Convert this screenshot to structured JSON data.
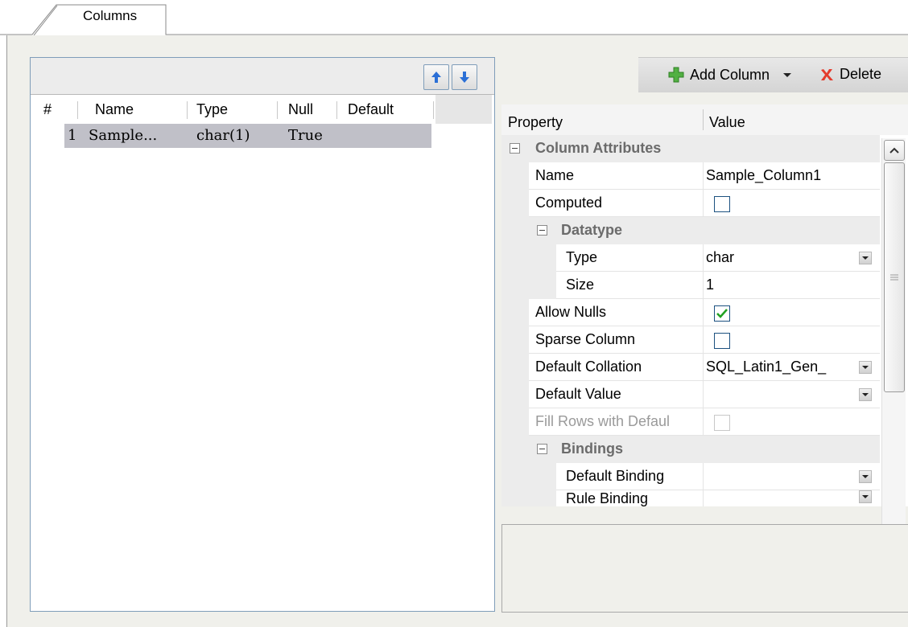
{
  "tab": {
    "label": "Columns"
  },
  "columns_grid": {
    "headers": [
      "#",
      "Name",
      "Type",
      "Null",
      "Default"
    ],
    "rows": [
      {
        "index": "1",
        "name": "Sample...",
        "type": "char(1)",
        "null": "True",
        "default": ""
      }
    ]
  },
  "toolbar": {
    "add_column": "Add Column",
    "delete": "Delete"
  },
  "properties": {
    "header_property": "Property",
    "header_value": "Value",
    "cat_column_attributes": "Column Attributes",
    "name_label": "Name",
    "name_value": "Sample_Column1",
    "computed_label": "Computed",
    "computed_checked": false,
    "cat_datatype": "Datatype",
    "type_label": "Type",
    "type_value": "char",
    "size_label": "Size",
    "size_value": "1",
    "allow_nulls_label": "Allow Nulls",
    "allow_nulls_checked": true,
    "sparse_label": "Sparse Column",
    "sparse_checked": false,
    "collation_label": "Default Collation",
    "collation_value": "SQL_Latin1_Gen_",
    "default_value_label": "Default Value",
    "default_value_value": "",
    "fill_rows_label": "Fill Rows with Defaul",
    "fill_rows_checked": false,
    "cat_bindings": "Bindings",
    "default_binding_label": "Default Binding",
    "rule_binding_label": "Rule Binding"
  },
  "colors": {
    "selection": "#c0c0c8",
    "panel_bg": "#f0f0eb",
    "check_green": "#21a121",
    "arrow_blue": "#2b6fd6"
  }
}
